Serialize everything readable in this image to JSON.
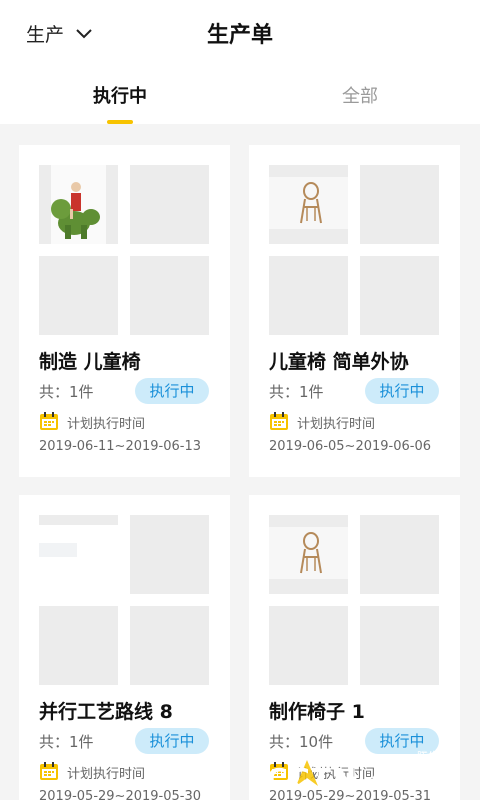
{
  "header": {
    "scope_label": "生产",
    "title": "生产单"
  },
  "tabs": [
    {
      "label": "执行中",
      "active": true
    },
    {
      "label": "全部",
      "active": false
    }
  ],
  "cards": [
    {
      "title": "制造 儿童椅",
      "count": "共：1件",
      "status": "执行中",
      "plan_label": "计划执行时间",
      "date_range": "2019-06-11~2019-06-13",
      "image": "green-horse-chair-image"
    },
    {
      "title": "儿童椅 简单外协",
      "count": "共：1件",
      "status": "执行中",
      "plan_label": "计划执行时间",
      "date_range": "2019-06-05~2019-06-06",
      "image": "wooden-chair-image"
    },
    {
      "title": "并行工艺路线 8",
      "count": "共：1件",
      "status": "执行中",
      "plan_label": "计划执行时间",
      "date_range": "2019-05-29~2019-05-30",
      "image": "placeholder-image"
    },
    {
      "title": "制作椅子 1",
      "count": "共：10件",
      "status": "执行中",
      "plan_label": "计划执行时间",
      "date_range": "2019-05-29~2019-05-31",
      "image": "wooden-chair-image"
    }
  ],
  "watermark": {
    "small_text": "腾牛网",
    "big_text": "CCTN.com"
  },
  "colors": {
    "accent": "#f7c300",
    "badge_bg": "#cdebfa",
    "badge_text": "#1a90d9",
    "background": "#f4f4f4"
  }
}
